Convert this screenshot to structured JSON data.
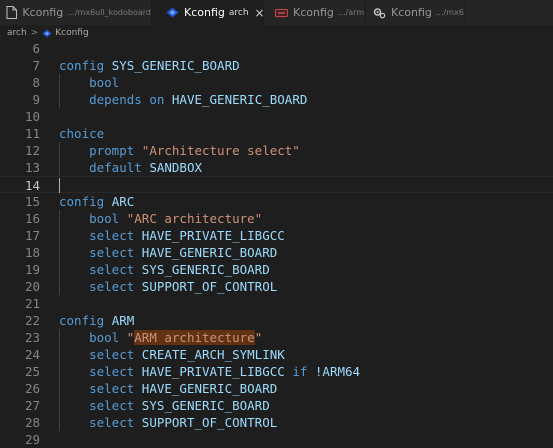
{
  "tabs": [
    {
      "name": "Kconfig",
      "path": ".../mx6ull_kodoboard",
      "active": false,
      "icon": "file-icon"
    },
    {
      "name": "Kconfig",
      "path": "arch",
      "active": true,
      "icon": "kconfig-icon",
      "close": "×"
    },
    {
      "name": "Kconfig",
      "path": ".../arm",
      "active": false,
      "icon": "kconfig-file-icon"
    },
    {
      "name": "Kconfig",
      "path": ".../mx6",
      "active": false,
      "icon": "gear-file-icon"
    }
  ],
  "breadcrumb": {
    "folder": "arch",
    "separator": ">",
    "file": "Kconfig"
  },
  "colors": {
    "keyword": "#569cd6",
    "text": "#9cdcfe",
    "string": "#ce9178",
    "match_highlight": "#613214",
    "background": "#1e1e1e"
  },
  "editor": {
    "current_line": "14",
    "lines": [
      {
        "num": "6",
        "parts": []
      },
      {
        "num": "7",
        "parts": [
          {
            "t": "config ",
            "c": "kw"
          },
          {
            "t": "SYS_GENERIC_BOARD",
            "c": "tx"
          }
        ]
      },
      {
        "num": "8",
        "parts": [
          {
            "t": "    "
          },
          {
            "t": "bool",
            "c": "kw"
          }
        ]
      },
      {
        "num": "9",
        "parts": [
          {
            "t": "    "
          },
          {
            "t": "depends on ",
            "c": "kw"
          },
          {
            "t": "HAVE_GENERIC_BOARD",
            "c": "tx"
          }
        ]
      },
      {
        "num": "10",
        "parts": []
      },
      {
        "num": "11",
        "parts": [
          {
            "t": "choice",
            "c": "kw"
          }
        ]
      },
      {
        "num": "12",
        "parts": [
          {
            "t": "    "
          },
          {
            "t": "prompt ",
            "c": "kw"
          },
          {
            "t": "\"Architecture select\"",
            "c": "str"
          }
        ]
      },
      {
        "num": "13",
        "parts": [
          {
            "t": "    "
          },
          {
            "t": "default ",
            "c": "kw"
          },
          {
            "t": "SANDBOX",
            "c": "tx"
          }
        ]
      },
      {
        "num": "14",
        "parts": []
      },
      {
        "num": "15",
        "parts": [
          {
            "t": "config ",
            "c": "kw"
          },
          {
            "t": "ARC",
            "c": "tx"
          }
        ]
      },
      {
        "num": "16",
        "parts": [
          {
            "t": "    "
          },
          {
            "t": "bool ",
            "c": "kw"
          },
          {
            "t": "\"ARC architecture\"",
            "c": "str"
          }
        ]
      },
      {
        "num": "17",
        "parts": [
          {
            "t": "    "
          },
          {
            "t": "select ",
            "c": "kw"
          },
          {
            "t": "HAVE_PRIVATE_LIBGCC",
            "c": "tx"
          }
        ]
      },
      {
        "num": "18",
        "parts": [
          {
            "t": "    "
          },
          {
            "t": "select ",
            "c": "kw"
          },
          {
            "t": "HAVE_GENERIC_BOARD",
            "c": "tx"
          }
        ]
      },
      {
        "num": "19",
        "parts": [
          {
            "t": "    "
          },
          {
            "t": "select ",
            "c": "kw"
          },
          {
            "t": "SYS_GENERIC_BOARD",
            "c": "tx"
          }
        ]
      },
      {
        "num": "20",
        "parts": [
          {
            "t": "    "
          },
          {
            "t": "select ",
            "c": "kw"
          },
          {
            "t": "SUPPORT_OF_CONTROL",
            "c": "tx"
          }
        ]
      },
      {
        "num": "21",
        "parts": []
      },
      {
        "num": "22",
        "parts": [
          {
            "t": "config ",
            "c": "kw"
          },
          {
            "t": "ARM",
            "c": "tx"
          }
        ]
      },
      {
        "num": "23",
        "parts": [
          {
            "t": "    "
          },
          {
            "t": "bool ",
            "c": "kw"
          },
          {
            "t": "\"",
            "c": "str"
          },
          {
            "t": "ARM architecture",
            "c": "str hl"
          },
          {
            "t": "\"",
            "c": "str"
          }
        ]
      },
      {
        "num": "24",
        "parts": [
          {
            "t": "    "
          },
          {
            "t": "select ",
            "c": "kw"
          },
          {
            "t": "CREATE_ARCH_SYMLINK",
            "c": "tx"
          }
        ]
      },
      {
        "num": "25",
        "parts": [
          {
            "t": "    "
          },
          {
            "t": "select ",
            "c": "kw"
          },
          {
            "t": "HAVE_PRIVATE_LIBGCC ",
            "c": "tx"
          },
          {
            "t": "if ",
            "c": "kw"
          },
          {
            "t": "!ARM64",
            "c": "tx"
          }
        ]
      },
      {
        "num": "26",
        "parts": [
          {
            "t": "    "
          },
          {
            "t": "select ",
            "c": "kw"
          },
          {
            "t": "HAVE_GENERIC_BOARD",
            "c": "tx"
          }
        ]
      },
      {
        "num": "27",
        "parts": [
          {
            "t": "    "
          },
          {
            "t": "select ",
            "c": "kw"
          },
          {
            "t": "SYS_GENERIC_BOARD",
            "c": "tx"
          }
        ]
      },
      {
        "num": "28",
        "parts": [
          {
            "t": "    "
          },
          {
            "t": "select ",
            "c": "kw"
          },
          {
            "t": "SUPPORT_OF_CONTROL",
            "c": "tx"
          }
        ]
      },
      {
        "num": "29",
        "parts": []
      }
    ]
  }
}
